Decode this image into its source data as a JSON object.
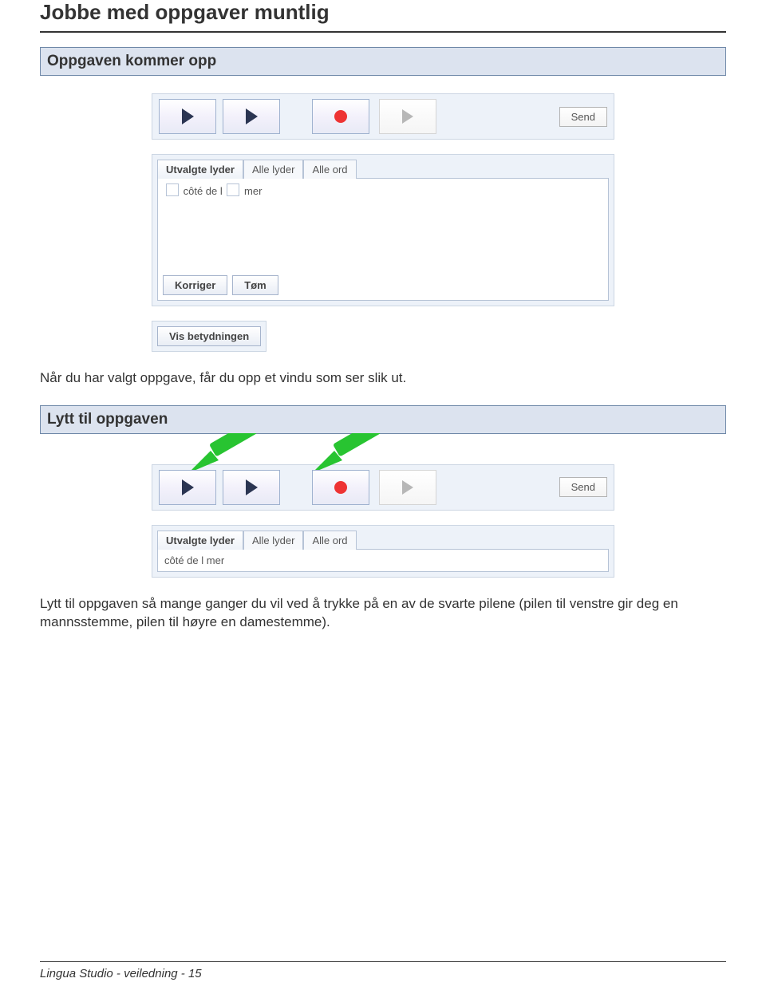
{
  "page": {
    "title": "Jobbe med oppgaver muntlig",
    "footer": "Lingua Studio - veiledning - 15"
  },
  "section1": {
    "header": "Oppgaven kommer opp",
    "toolbar": {
      "play1_name": "play-icon",
      "play2_name": "play-icon",
      "record_name": "record-icon",
      "play_grey_name": "play-disabled-icon",
      "send_label": "Send"
    },
    "tabs": {
      "t1": "Utvalgte lyder",
      "t2": "Alle lyder",
      "t3": "Alle ord"
    },
    "cloze": {
      "part1": "côté  de  l",
      "part2": "mer"
    },
    "buttons": {
      "korriger": "Korriger",
      "tom": "Tøm",
      "vis": "Vis betydningen"
    },
    "caption": "Når du har valgt oppgave, får du opp et vindu som ser slik ut."
  },
  "section2": {
    "header": "Lytt til oppgaven",
    "toolbar": {
      "play1_name": "play-icon",
      "play2_name": "play-icon",
      "record_name": "record-icon",
      "play_grey_name": "play-disabled-icon",
      "send_label": "Send"
    },
    "tabs": {
      "t1": "Utvalgte lyder",
      "t2": "Alle lyder",
      "t3": "Alle ord"
    },
    "cloze": {
      "part1": "côté  de  l",
      "part2": "mer"
    },
    "caption": "Lytt til oppgaven så mange ganger du vil ved å trykke på en av de svarte pilene (pilen til venstre gir deg en mannsstemme, pilen til høyre en damestemme).",
    "arrow_color": "#28c431"
  }
}
